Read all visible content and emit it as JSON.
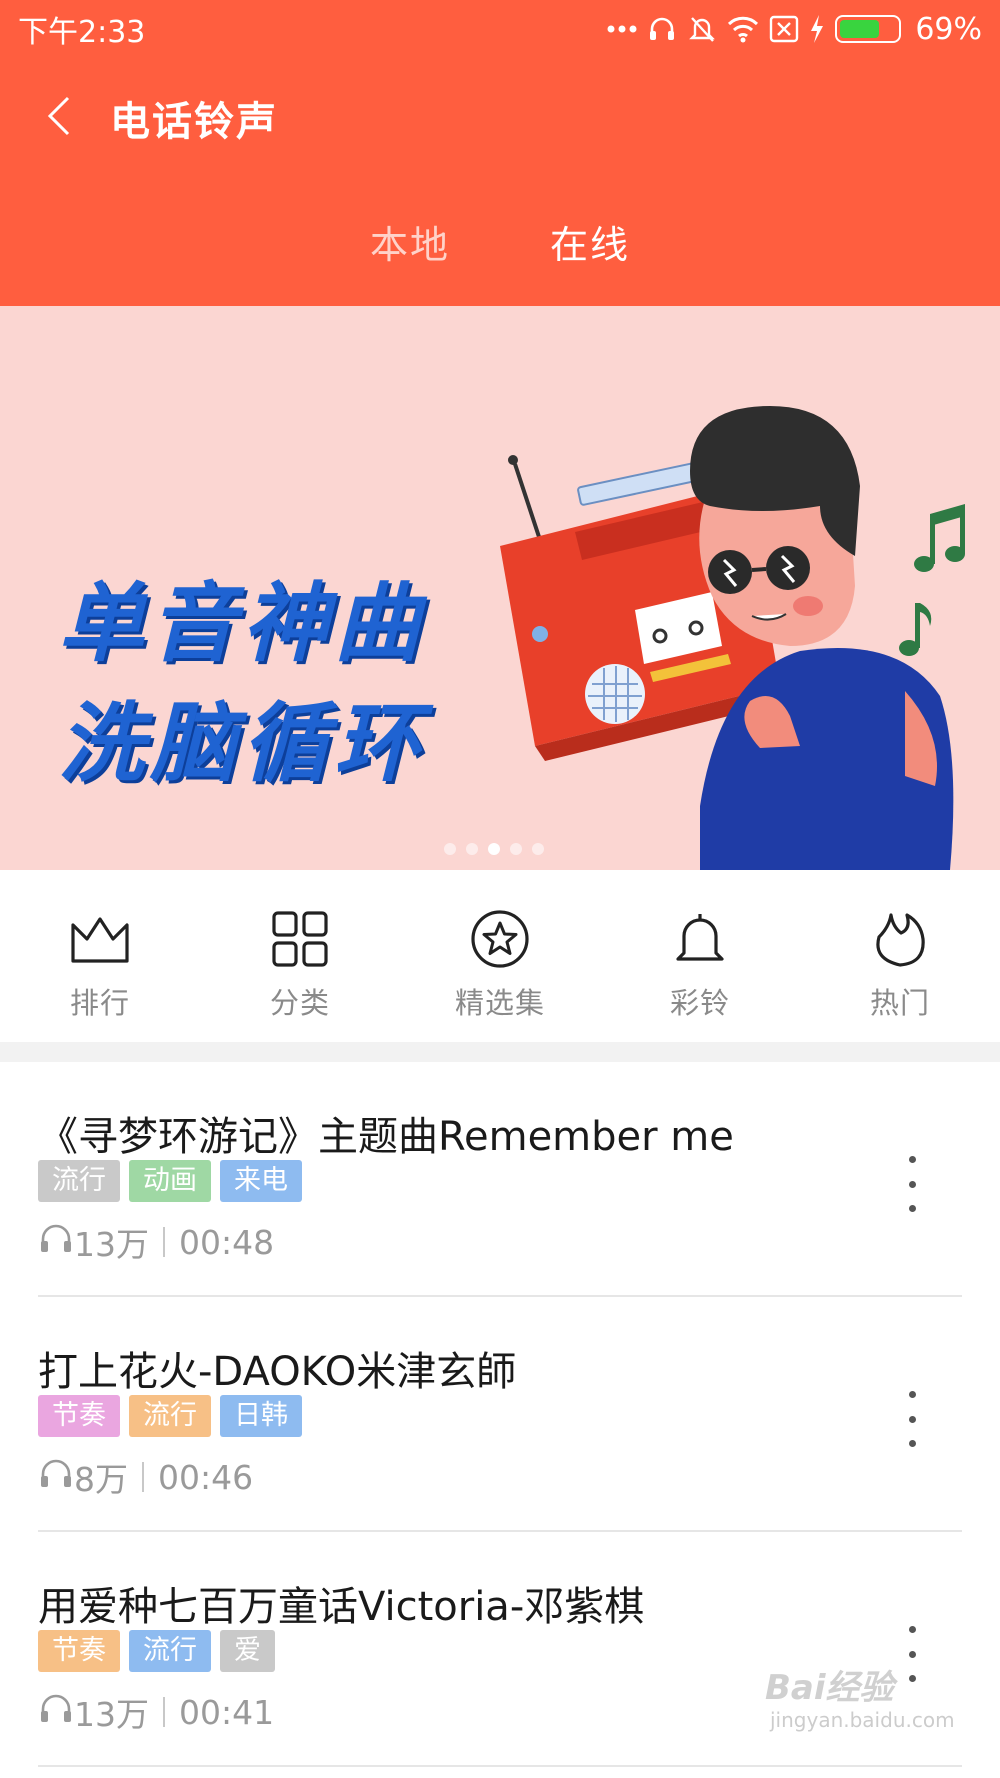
{
  "status_bar": {
    "time": "下午2:33",
    "battery": "69%",
    "battery_level": 0.69,
    "battery_color": "#39d43f",
    "icons": [
      "more-dots-icon",
      "headset-icon",
      "mute-bell-icon",
      "wifi-icon",
      "sim-off-icon",
      "charging-icon",
      "battery-icon"
    ]
  },
  "header": {
    "title": "电话铃声",
    "back_icon": "chevron-left-icon",
    "background": "#ff5e3f",
    "tabs": [
      {
        "label": "本地",
        "active": false
      },
      {
        "label": "在线",
        "active": true
      }
    ]
  },
  "banner": {
    "line1": "单音神曲",
    "line2": "洗脑循环",
    "slide_count": 5,
    "active_slide": 3
  },
  "quick_nav": [
    {
      "label": "排行",
      "icon": "crown-icon"
    },
    {
      "label": "分类",
      "icon": "grid-icon"
    },
    {
      "label": "精选集",
      "icon": "star-circle-icon"
    },
    {
      "label": "彩铃",
      "icon": "bell-icon"
    },
    {
      "label": "热门",
      "icon": "flame-icon"
    }
  ],
  "songs": [
    {
      "title": "《寻梦环游记》主题曲Remember me",
      "tags": [
        {
          "label": "流行",
          "color": "#c9c9c9"
        },
        {
          "label": "动画",
          "color": "#9fd8a4"
        },
        {
          "label": "来电",
          "color": "#8ebbf0"
        }
      ],
      "plays": "13万",
      "duration": "00:48"
    },
    {
      "title": "打上花火-DAOKO米津玄師",
      "tags": [
        {
          "label": "节奏",
          "color": "#eaa6e0"
        },
        {
          "label": "流行",
          "color": "#f7c086"
        },
        {
          "label": "日韩",
          "color": "#8ebbf0"
        }
      ],
      "plays": "8万",
      "duration": "00:46"
    },
    {
      "title": "用爱种七百万童话Victoria-邓紫棋",
      "tags": [
        {
          "label": "节奏",
          "color": "#f7c086"
        },
        {
          "label": "流行",
          "color": "#8ebbf0"
        },
        {
          "label": "爱",
          "color": "#c9c9c9"
        }
      ],
      "plays": "13万",
      "duration": "00:41"
    }
  ],
  "watermark": {
    "text": "Bai经验",
    "sub": "jingyan.baidu.com"
  }
}
